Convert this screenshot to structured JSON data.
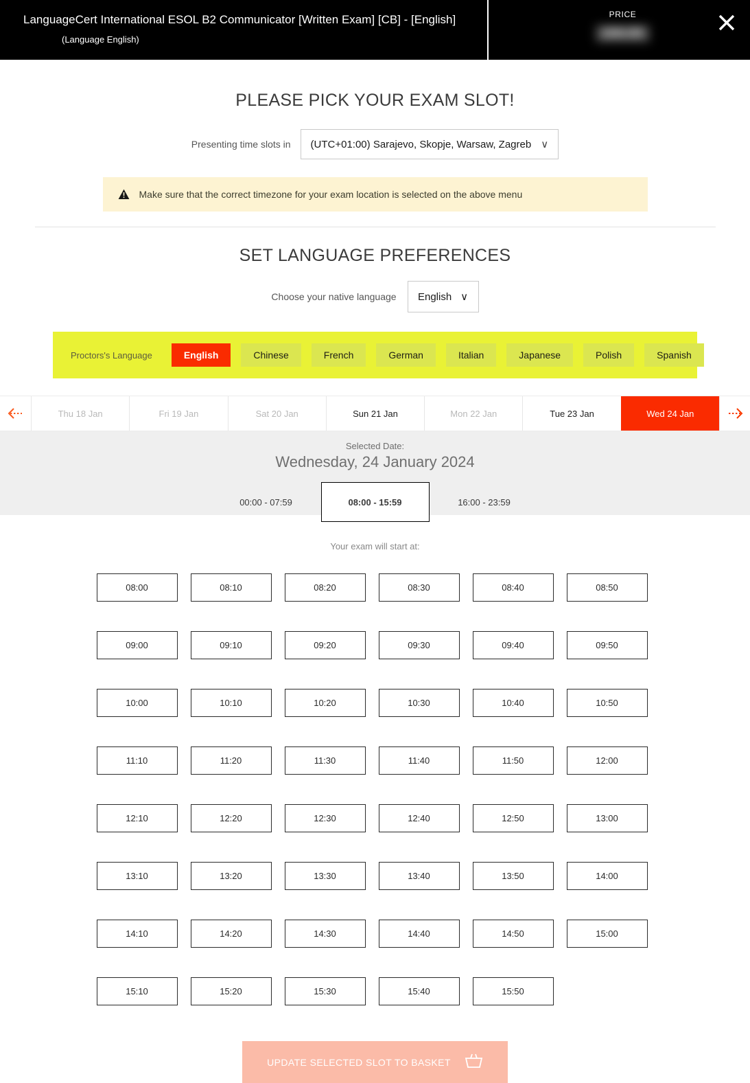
{
  "header": {
    "exam_title": "LanguageCert International ESOL B2 Communicator [Written Exam] [CB] - [English]",
    "language_note": "(Language English)",
    "price_label": "PRICE",
    "price_value": "£84.00",
    "close_icon": "close-icon"
  },
  "pick_slot": {
    "title": "PLEASE PICK YOUR EXAM SLOT!",
    "timezone_label": "Presenting time slots in",
    "timezone_value": "(UTC+01:00) Sarajevo, Skopje, Warsaw, Zagreb",
    "chevron": "∨",
    "alert_icon": "warning-triangle-icon",
    "alert_text": "Make sure that the correct timezone for your exam location is selected on the above menu"
  },
  "language_prefs": {
    "title": "SET LANGUAGE PREFERENCES",
    "native_label": "Choose your native language",
    "native_value": "English",
    "chevron": "∨",
    "proctor_label": "Proctors's Language",
    "proctor_languages": [
      {
        "label": "English",
        "selected": true
      },
      {
        "label": "Chinese",
        "selected": false
      },
      {
        "label": "French",
        "selected": false
      },
      {
        "label": "German",
        "selected": false
      },
      {
        "label": "Italian",
        "selected": false
      },
      {
        "label": "Japanese",
        "selected": false
      },
      {
        "label": "Polish",
        "selected": false
      },
      {
        "label": "Spanish",
        "selected": false
      }
    ]
  },
  "date_strip": {
    "prev_icon": "arrow-left-dashed-icon",
    "next_icon": "arrow-right-dashed-icon",
    "dates": [
      {
        "label": "Thu 18 Jan",
        "state": "disabled"
      },
      {
        "label": "Fri 19 Jan",
        "state": "disabled"
      },
      {
        "label": "Sat 20 Jan",
        "state": "disabled"
      },
      {
        "label": "Sun 21 Jan",
        "state": "available"
      },
      {
        "label": "Mon 22 Jan",
        "state": "disabled"
      },
      {
        "label": "Tue 23 Jan",
        "state": "available"
      },
      {
        "label": "Wed 24 Jan",
        "state": "selected"
      }
    ]
  },
  "selected_date": {
    "caption": "Selected Date:",
    "value": "Wednesday, 24 January 2024",
    "periods": [
      {
        "label": "00:00 - 07:59",
        "active": false
      },
      {
        "label": "08:00 - 15:59",
        "active": true
      },
      {
        "label": "16:00 - 23:59",
        "active": false
      }
    ]
  },
  "slots": {
    "caption": "Your exam will start at:",
    "times": [
      "08:00",
      "08:10",
      "08:20",
      "08:30",
      "08:40",
      "08:50",
      "09:00",
      "09:10",
      "09:20",
      "09:30",
      "09:40",
      "09:50",
      "10:00",
      "10:10",
      "10:20",
      "10:30",
      "10:40",
      "10:50",
      "11:10",
      "11:20",
      "11:30",
      "11:40",
      "11:50",
      "12:00",
      "12:10",
      "12:20",
      "12:30",
      "12:40",
      "12:50",
      "13:00",
      "13:10",
      "13:20",
      "13:30",
      "13:40",
      "13:50",
      "14:00",
      "14:10",
      "14:20",
      "14:30",
      "14:40",
      "14:50",
      "15:00",
      "15:10",
      "15:20",
      "15:30",
      "15:40",
      "15:50"
    ]
  },
  "footer": {
    "basket_label": "UPDATE SELECTED SLOT TO BASKET",
    "basket_icon": "basket-icon"
  },
  "colors": {
    "accent": "#fa2b00",
    "accent_muted": "#fbbba8",
    "band_yellow": "#e9f235",
    "chip_yellow": "#dbe650",
    "alert_bg": "#fdf3d2",
    "panel_gray": "#efefef",
    "header_bg": "#000000"
  }
}
